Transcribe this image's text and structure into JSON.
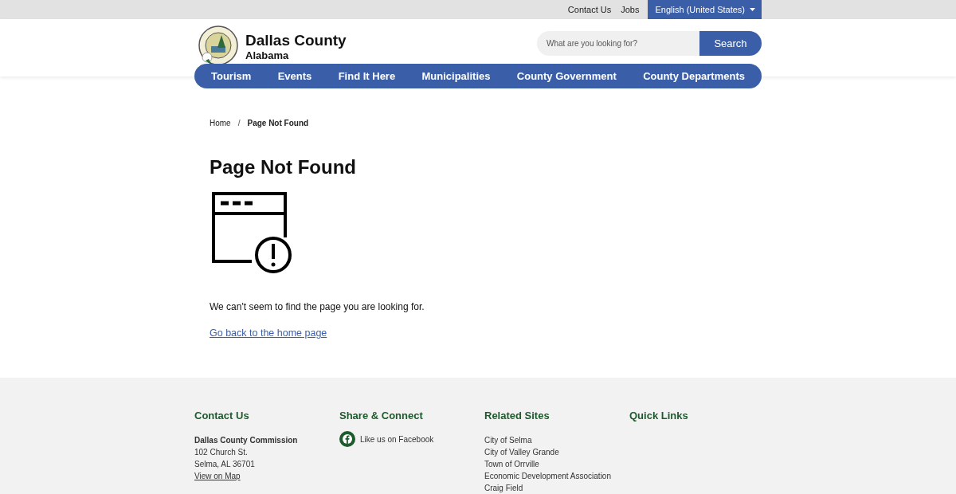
{
  "utility_bar": {
    "links": [
      "Contact Us",
      "Jobs"
    ],
    "language": "English (United States)"
  },
  "header": {
    "title": "Dallas County",
    "subtitle": "Alabama",
    "search": {
      "placeholder": "What are you looking for?",
      "button": "Search"
    }
  },
  "nav": {
    "items": [
      "Tourism",
      "Events",
      "Find It Here",
      "Municipalities",
      "County Government",
      "County Departments"
    ]
  },
  "breadcrumb": {
    "items": [
      "Home",
      "Page Not Found"
    ],
    "separator": "/"
  },
  "main": {
    "heading": "Page Not Found",
    "message": "We can't seem to find the page you are looking for.",
    "link": "Go back to the home page"
  },
  "footer": {
    "columns": [
      {
        "kind": "contact",
        "heading": "Contact Us",
        "name": "Dallas County Commission",
        "lines": [
          "102 Church St.",
          "Selma, AL 36701"
        ],
        "link": "View on Map"
      },
      {
        "kind": "social",
        "heading": "Share & Connect",
        "items": [
          "Like us on Facebook"
        ]
      },
      {
        "kind": "links",
        "heading": "Related Sites",
        "items": [
          "City of Selma",
          "City of Valley Grande",
          "Town of Orrville",
          "Economic Development Association",
          "Craig Field"
        ]
      },
      {
        "kind": "links",
        "heading": "Quick Links"
      }
    ]
  }
}
